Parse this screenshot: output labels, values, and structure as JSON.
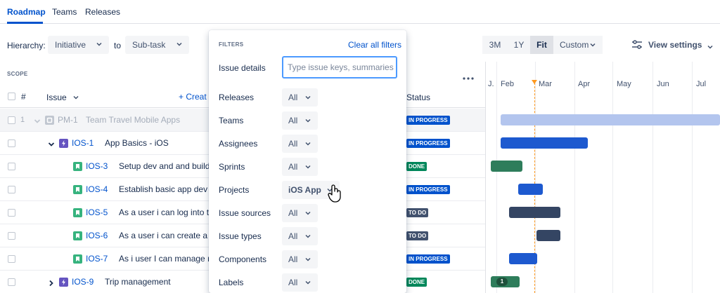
{
  "tabs": [
    {
      "label": "Roadmap",
      "active": true
    },
    {
      "label": "Teams",
      "active": false
    },
    {
      "label": "Releases",
      "active": false
    }
  ],
  "toolbar": {
    "hierarchy_label": "Hierarchy:",
    "hierarchy_from": "Initiative",
    "to_label": "to",
    "hierarchy_to": "Sub-task",
    "zoom_options": [
      "3M",
      "1Y",
      "Fit",
      "Custom"
    ],
    "zoom_selected": "Fit",
    "view_settings_label": "View settings"
  },
  "scope": {
    "label": "SCOPE",
    "more_icon": "more-horizontal-icon",
    "columns": {
      "number": "#",
      "issue": "Issue",
      "create": "+ Creat",
      "status": "Status"
    }
  },
  "rows": [
    {
      "num": "1",
      "key": "PM-1",
      "title": "Team Travel Mobile Apps",
      "type": "initiative",
      "status": "IN PROGRESS",
      "dim": true
    },
    {
      "num": "",
      "key": "IOS-1",
      "title": "App Basics - iOS",
      "type": "epic",
      "status": "IN PROGRESS",
      "dim": false
    },
    {
      "num": "",
      "key": "IOS-3",
      "title": "Setup dev and and build en",
      "type": "story",
      "status": "DONE",
      "dim": false
    },
    {
      "num": "",
      "key": "IOS-4",
      "title": "Establish basic app dev fra",
      "type": "story",
      "status": "IN PROGRESS",
      "dim": false
    },
    {
      "num": "",
      "key": "IOS-5",
      "title": "As a user i can log into the s",
      "type": "story",
      "status": "TO DO",
      "dim": false
    },
    {
      "num": "",
      "key": "IOS-6",
      "title": "As a user i can create a cus",
      "type": "story",
      "status": "TO DO",
      "dim": false
    },
    {
      "num": "",
      "key": "IOS-7",
      "title": "As i user I can manage my p",
      "type": "story",
      "status": "IN PROGRESS",
      "dim": false
    },
    {
      "num": "",
      "key": "IOS-9",
      "title": "Trip management",
      "type": "epic",
      "status": "DONE",
      "dim": false
    }
  ],
  "timeline": {
    "months": [
      "J.",
      "Feb",
      "Mar",
      "Apr",
      "May",
      "Jun",
      "Jul"
    ],
    "bar_badge": "1"
  },
  "filters": {
    "title": "FILTERS",
    "clear_label": "Clear all filters",
    "issue_details_label": "Issue details",
    "issue_details_placeholder": "Type issue keys, summaries",
    "items": [
      {
        "label": "Releases",
        "value": "All"
      },
      {
        "label": "Teams",
        "value": "All"
      },
      {
        "label": "Assignees",
        "value": "All"
      },
      {
        "label": "Sprints",
        "value": "All"
      },
      {
        "label": "Projects",
        "value": "iOS App"
      },
      {
        "label": "Issue sources",
        "value": "All"
      },
      {
        "label": "Issue types",
        "value": "All"
      },
      {
        "label": "Components",
        "value": "All"
      },
      {
        "label": "Labels",
        "value": "All"
      }
    ]
  },
  "colors": {
    "accent": "#0052cc",
    "in_progress": "#0052cc",
    "done": "#00875a",
    "todo": "#42526e"
  }
}
